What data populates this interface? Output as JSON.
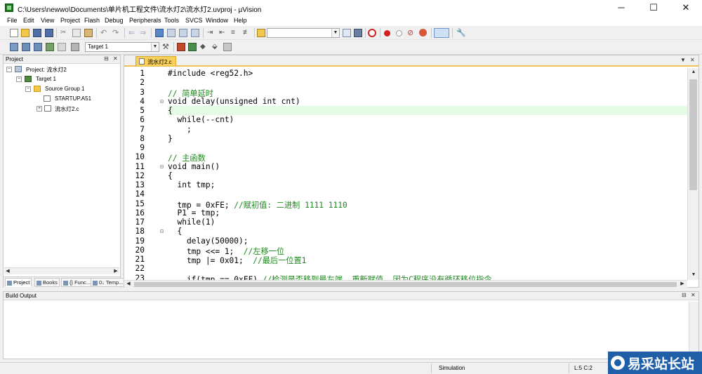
{
  "window": {
    "title": "C:\\Users\\newwo\\Documents\\单片机工程文件\\流水灯2\\流水灯2.uvproj - µVision",
    "controls": {
      "minimize": "─",
      "maximize": "☐",
      "close": "✕"
    }
  },
  "menu": [
    "File",
    "Edit",
    "View",
    "Project",
    "Flash",
    "Debug",
    "Peripherals",
    "Tools",
    "SVCS",
    "Window",
    "Help"
  ],
  "toolbar": {
    "target_select": "Target 1"
  },
  "project_panel": {
    "title": "Project",
    "pin": "⊟",
    "close": "✕",
    "tree": {
      "project": "Project: 流水灯2",
      "target": "Target 1",
      "group": "Source Group 1",
      "files": [
        "STARTUP.A51",
        "流水灯2.c"
      ]
    },
    "tabs": [
      "Project",
      "Books",
      "{} Func...",
      "0↓ Temp..."
    ]
  },
  "editor": {
    "tab_label": "流水灯2.c",
    "current_line": 5,
    "lines": [
      {
        "n": "1",
        "text": "#include <reg52.h>"
      },
      {
        "n": "2",
        "text": ""
      },
      {
        "n": "3",
        "text": "// 简单延时"
      },
      {
        "n": "4",
        "text": "void delay(unsigned int cnt)"
      },
      {
        "n": "5",
        "text": "{"
      },
      {
        "n": "6",
        "text": "  while(--cnt)"
      },
      {
        "n": "7",
        "text": "    ;"
      },
      {
        "n": "8",
        "text": "}"
      },
      {
        "n": "9",
        "text": ""
      },
      {
        "n": "10",
        "text": "// 主函数"
      },
      {
        "n": "11",
        "text": "void main()"
      },
      {
        "n": "12",
        "text": "{"
      },
      {
        "n": "13",
        "text": "  int tmp;"
      },
      {
        "n": "14",
        "text": ""
      },
      {
        "n": "15",
        "text": "  tmp = 0xFE; //赋初值: 二进制 1111 1110"
      },
      {
        "n": "16",
        "text": "  P1 = tmp;"
      },
      {
        "n": "17",
        "text": "  while(1)"
      },
      {
        "n": "18",
        "text": "  {"
      },
      {
        "n": "19",
        "text": "    delay(50000);"
      },
      {
        "n": "20",
        "text": "    tmp <<= 1;  //左移一位"
      },
      {
        "n": "21",
        "text": "    tmp |= 0x01;  //最后一位置1"
      },
      {
        "n": "22",
        "text": ""
      },
      {
        "n": "23",
        "text": "    if(tmp == 0xFF) //检测是否移到最左端, 重新赋值, 因为C程序没有循环移位指令"
      }
    ],
    "comments": {
      "l3": "// 简单延时",
      "l10": "// 主函数",
      "l15_code": "  tmp = 0xFE; ",
      "l15_cmt": "//赋初值: 二进制 1111 1110",
      "l20_code": "    tmp <<= 1;  ",
      "l20_cmt": "//左移一位",
      "l21_code": "    tmp |= 0x01;  ",
      "l21_cmt": "//最后一位置1",
      "l23_code": "    if(tmp == 0xFF) ",
      "l23_cmt": "//检测是否移到最左端, 重新赋值, 因为C程序没有循环移位指令"
    }
  },
  "build_output": {
    "title": "Build Output"
  },
  "status": {
    "mode": "Simulation",
    "position": "L:5 C:2"
  },
  "watermark": "易采站长站"
}
